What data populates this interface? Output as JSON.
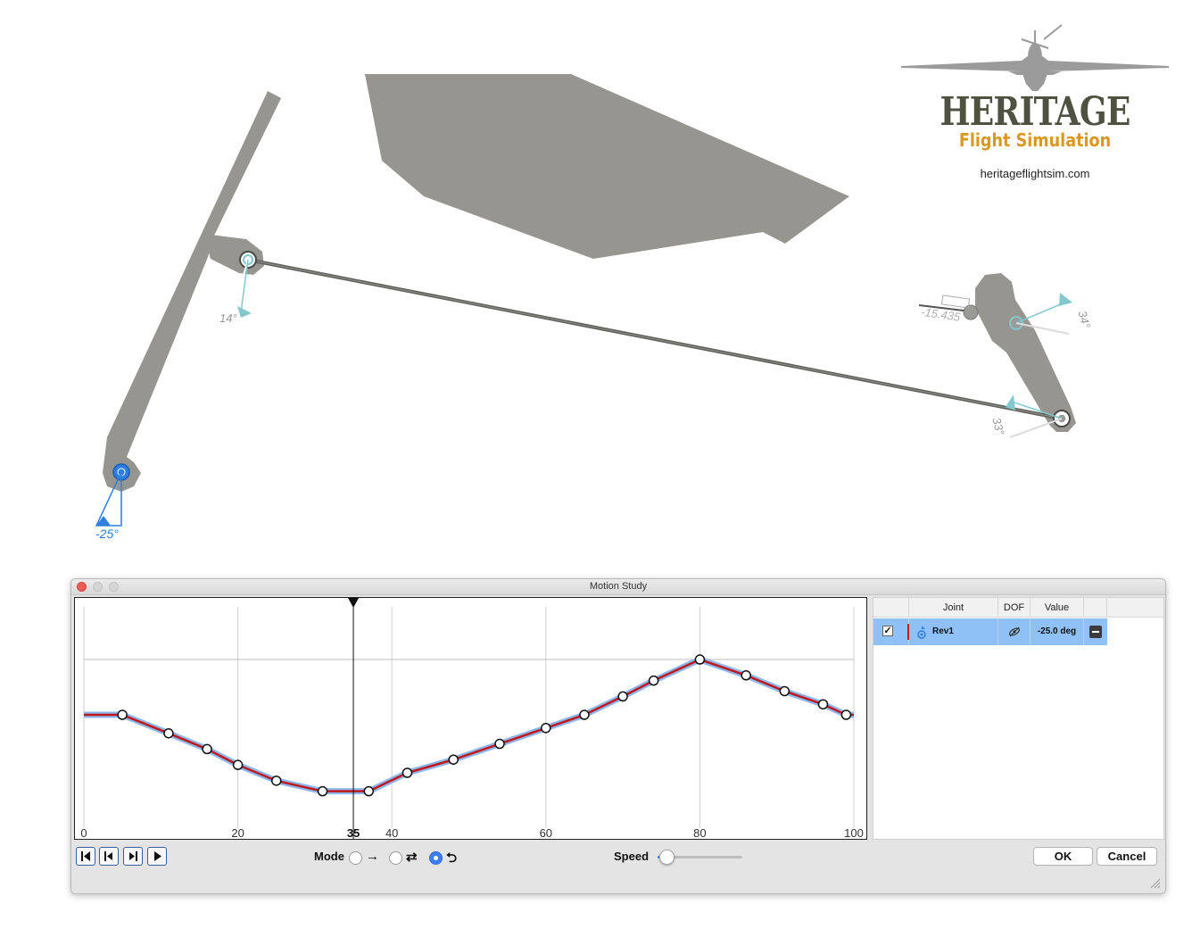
{
  "viewport": {
    "angle_labels": {
      "crank_left": "-25°",
      "pivot_upper": "14°",
      "arm_right_lower": "33°",
      "arm_right_upper": "34°",
      "input_value": "-15.435"
    },
    "colors": {
      "part": "#969590",
      "rod": "#5e5e5a",
      "selected": "#2f7fe0",
      "angle_marker": "#82c8cc"
    }
  },
  "logo": {
    "title": "HERITAGE",
    "subtitle": "Flight Simulation",
    "url": "heritageflightsim.com"
  },
  "window": {
    "title": "Motion Study"
  },
  "graph": {
    "x_ticks": [
      "0",
      "20",
      "40",
      "60",
      "80",
      "100"
    ],
    "current_step": "35",
    "curve_color": "#c0191d",
    "halo_color": "#8db8ec"
  },
  "chart_data": {
    "type": "line",
    "x": [
      0,
      5,
      11,
      16,
      20,
      25,
      31,
      37,
      42,
      48,
      54,
      60,
      65,
      70,
      74,
      80,
      86,
      91,
      96,
      99,
      100
    ],
    "series": [
      {
        "values": [
          -34.5,
          -34.5,
          -38,
          -41,
          -44,
          -47,
          -49,
          -49,
          -45.5,
          -43,
          -40,
          -37,
          -34.5,
          -31,
          -28,
          -24,
          -27,
          -30,
          -32.5,
          -34.5,
          -34.5
        ]
      }
    ],
    "xlim": [
      0,
      100
    ],
    "current_x": 35,
    "grid": true
  },
  "joints": {
    "headers": {
      "joint": "Joint",
      "dof": "DOF",
      "value": "Value"
    },
    "rows": [
      {
        "checked": "✓",
        "name": "Rev1",
        "value": "-25.0 deg"
      }
    ]
  },
  "controls": {
    "mode_label": "Mode",
    "mode_icons": [
      "→",
      "⇄",
      "⮌"
    ],
    "mode_selected": 2,
    "speed_label": "Speed",
    "speed_fraction": 0.1,
    "ok_label": "OK",
    "cancel_label": "Cancel"
  }
}
